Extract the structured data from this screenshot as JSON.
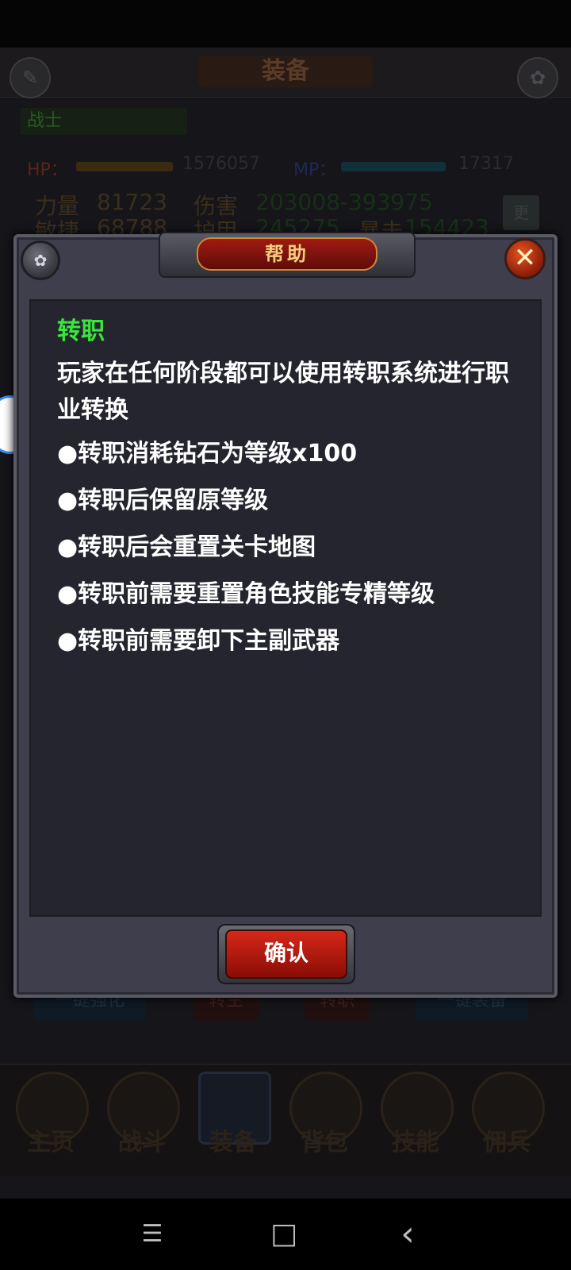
{
  "background": {
    "header_title": "装备",
    "class_name": "战士",
    "hp_label": "HP：",
    "hp_value": "1576057",
    "mp_label": "MP：",
    "mp_value": "17317",
    "stat_row1": [
      "力量",
      "81723",
      "伤害",
      "203008-393975"
    ],
    "stat_row2": [
      "敏捷",
      "68788",
      "护甲",
      "245275",
      "暴击",
      "154423"
    ],
    "more_label": "更",
    "actions": [
      "一键强化",
      "转生",
      "转职",
      "一键装备"
    ],
    "bottom_nav": [
      "主页",
      "战斗",
      "装备",
      "背包",
      "技能",
      "佣兵"
    ]
  },
  "dialog": {
    "title": "帮助",
    "close_glyph": "✕",
    "section_title": "转职",
    "intro": "玩家在任何阶段都可以使用转职系统进行职业转换",
    "rules": [
      "●转职消耗钻石为等级x100",
      "●转职后保留原等级",
      "●转职后会重置关卡地图",
      "●转职前需要重置角色技能专精等级",
      "●转职前需要卸下主副武器"
    ],
    "confirm_label": "确认"
  },
  "system_nav": {
    "menu_glyph": "☰",
    "home_glyph": "□",
    "back_glyph": "‹"
  }
}
